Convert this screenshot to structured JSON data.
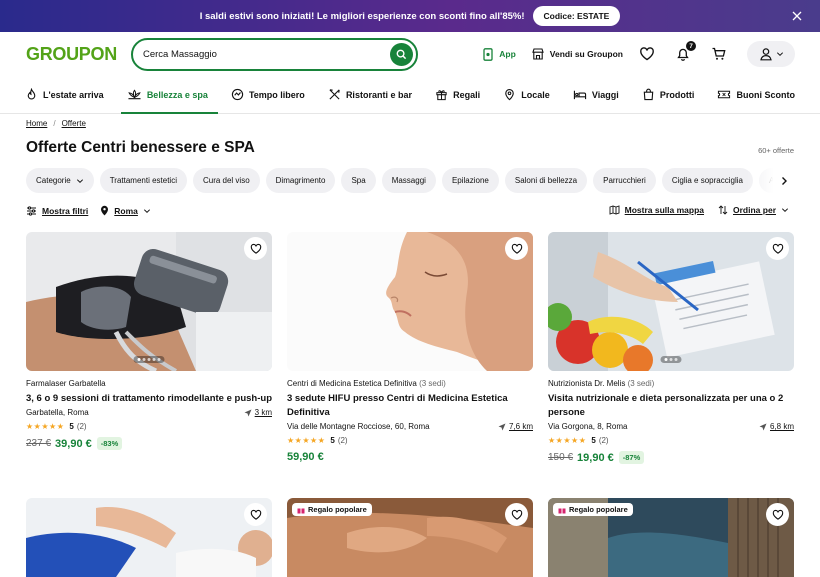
{
  "banner": {
    "message": "I saldi estivi sono iniziati! Le migliori esperienze con sconti fino all'85%!",
    "code": "Codice: ESTATE"
  },
  "header": {
    "logo": "GROUPON",
    "search_value": "Cerca Massaggio",
    "app_label": "App",
    "sell_label": "Vendi su Groupon",
    "notifications_count": "7"
  },
  "nav": [
    {
      "label": "L'estate arriva",
      "icon": "flame-icon"
    },
    {
      "label": "Bellezza e spa",
      "icon": "lotus-icon",
      "active": true
    },
    {
      "label": "Tempo libero",
      "icon": "activity-icon"
    },
    {
      "label": "Ristoranti e bar",
      "icon": "utensils-icon"
    },
    {
      "label": "Regali",
      "icon": "gift-icon"
    },
    {
      "label": "Locale",
      "icon": "location-icon"
    },
    {
      "label": "Viaggi",
      "icon": "bed-icon"
    },
    {
      "label": "Prodotti",
      "icon": "bag-icon"
    },
    {
      "label": "Buoni Sconto",
      "icon": "ticket-icon"
    }
  ],
  "breadcrumb": {
    "home": "Home",
    "current": "Offerte"
  },
  "page": {
    "title": "Offerte Centri benessere e SPA",
    "count": "60+ offerte"
  },
  "chips": [
    "Categorie",
    "Trattamenti estetici",
    "Cura del viso",
    "Dimagrimento",
    "Spa",
    "Massaggi",
    "Epilazione",
    "Saloni di bellezza",
    "Parrucchieri",
    "Ciglia e sopracciglia",
    "Al"
  ],
  "filters": {
    "show_filters": "Mostra filtri",
    "city": "Roma",
    "map": "Mostra sulla mappa",
    "sort": "Ordina per"
  },
  "cards": [
    {
      "merchant": "Farmalaser Garbatella",
      "sedi": "",
      "title": "3, 6 o 9 sessioni di trattamento rimodellante e push-up",
      "location": "Garbatella, Roma",
      "distance": "3 km",
      "stars": "★★★★★",
      "rating": "5",
      "reviews": "(2)",
      "old_price": "237 €",
      "price": "39,90 €",
      "discount": "-83%"
    },
    {
      "merchant": "Centri di Medicina Estetica Definitiva",
      "sedi": "(3 sedi)",
      "title": "3 sedute HIFU presso Centri di Medicina Estetica Definitiva",
      "location": "Via delle Montagne Rocciose, 60, Roma",
      "distance": "7,6 km",
      "stars": "★★★★★",
      "rating": "5",
      "reviews": "(2)",
      "old_price": "",
      "price": "59,90 €",
      "discount": ""
    },
    {
      "merchant": "Nutrizionista Dr. Melis",
      "sedi": "(3 sedi)",
      "title": "Visita nutrizionale e dieta personalizzata per una o 2 persone",
      "location": "Via Gorgona, 8, Roma",
      "distance": "6,8 km",
      "stars": "★★★★★",
      "rating": "5",
      "reviews": "(2)",
      "old_price": "150 €",
      "price": "19,90 €",
      "discount": "-87%"
    }
  ],
  "row2": {
    "tag": "Regalo popolare"
  },
  "colors": {
    "brand": "#53a318",
    "accent": "#18833a",
    "star": "#f5a623"
  }
}
